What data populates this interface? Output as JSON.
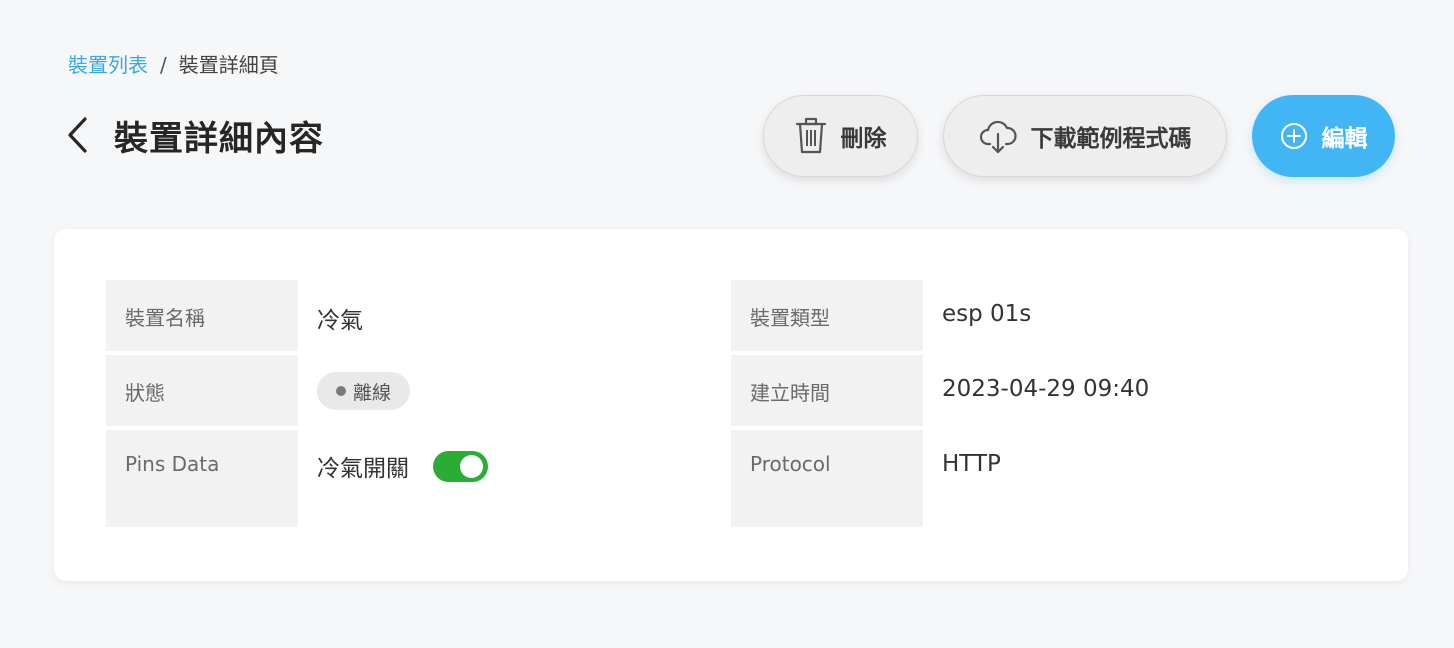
{
  "breadcrumb": {
    "parent": "裝置列表",
    "separator": "/",
    "current": "裝置詳細頁"
  },
  "header": {
    "title": "裝置詳細內容",
    "back_icon": "chevron-left-icon"
  },
  "actions": {
    "delete_label": "刪除",
    "delete_icon": "trash-icon",
    "download_label": "下載範例程式碼",
    "download_icon": "cloud-download-icon",
    "edit_label": "編輯",
    "edit_icon": "plus-circle-icon"
  },
  "details": {
    "name_label": "裝置名稱",
    "name_value": "冷氣",
    "type_label": "裝置類型",
    "type_value": "esp 01s",
    "status_label": "狀態",
    "status_value": "離線",
    "created_label": "建立時間",
    "created_value": "2023-04-29 09:40",
    "pins_label": "Pins Data",
    "pin_name": "冷氣開關",
    "pin_state": "on",
    "protocol_label": "Protocol",
    "protocol_value": "HTTP"
  },
  "colors": {
    "accent": "#42b6f5",
    "link": "#3aa7e8",
    "toggle_on": "#29ad32",
    "status_offline": "#7a7a7a"
  }
}
